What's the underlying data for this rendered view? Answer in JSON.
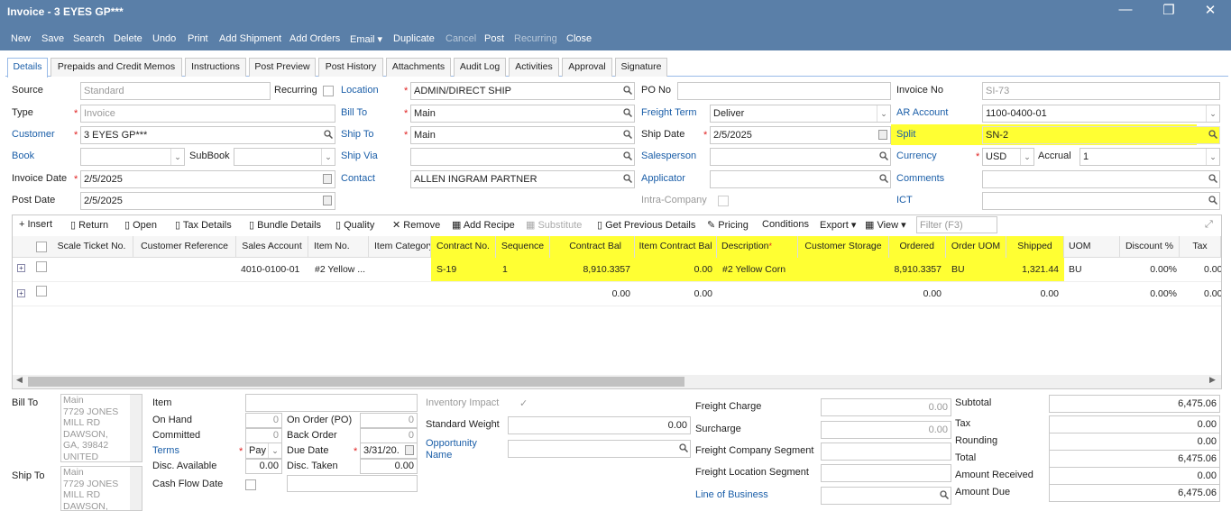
{
  "window": {
    "title": "Invoice - 3 EYES GP***"
  },
  "toolbar": [
    "New",
    "Save",
    "Search",
    "Delete",
    "Undo",
    "Print",
    "Add Shipment",
    "Add Orders",
    "Email ▾",
    "Duplicate",
    "Cancel",
    "Post",
    "Recurring",
    "Close"
  ],
  "tabs": [
    "Details",
    "Prepaids and Credit Memos",
    "Instructions",
    "Post Preview",
    "Post History",
    "Attachments",
    "Audit Log",
    "Activities",
    "Approval",
    "Signature"
  ],
  "form": {
    "source": {
      "label": "Source",
      "value": "Standard"
    },
    "recurring": {
      "label": "Recurring"
    },
    "location": {
      "label": "Location",
      "value": "ADMIN/DIRECT SHIP"
    },
    "po_no": {
      "label": "PO No",
      "value": ""
    },
    "invoice_no": {
      "label": "Invoice No",
      "value": "SI-73"
    },
    "type": {
      "label": "Type",
      "value": "Invoice"
    },
    "bill_to": {
      "label": "Bill To",
      "value": "Main"
    },
    "freight_term": {
      "label": "Freight Term",
      "value": "Deliver"
    },
    "ar_account": {
      "label": "AR Account",
      "value": "1100-0400-01"
    },
    "customer": {
      "label": "Customer",
      "value": "3 EYES GP***"
    },
    "ship_to": {
      "label": "Ship To",
      "value": "Main"
    },
    "ship_date": {
      "label": "Ship Date",
      "value": "2/5/2025"
    },
    "split": {
      "label": "Split",
      "value": "SN-2"
    },
    "book": {
      "label": "Book",
      "value": ""
    },
    "subbook": {
      "label": "SubBook",
      "value": ""
    },
    "ship_via": {
      "label": "Ship Via",
      "value": ""
    },
    "salesperson": {
      "label": "Salesperson",
      "value": ""
    },
    "currency": {
      "label": "Currency",
      "value": "USD"
    },
    "accrual": {
      "label": "Accrual",
      "value": "1"
    },
    "invoice_date": {
      "label": "Invoice Date",
      "value": "2/5/2025"
    },
    "contact": {
      "label": "Contact",
      "value": "ALLEN INGRAM PARTNER"
    },
    "applicator": {
      "label": "Applicator",
      "value": ""
    },
    "comments": {
      "label": "Comments",
      "value": ""
    },
    "post_date": {
      "label": "Post Date",
      "value": "2/5/2025"
    },
    "intra_company": {
      "label": "Intra-Company"
    },
    "ict": {
      "label": "ICT",
      "value": ""
    }
  },
  "grid_toolbar": [
    "Insert",
    "Return",
    "Open",
    "Tax Details",
    "Bundle Details",
    "Quality",
    "Remove",
    "Add Recipe",
    "Substitute",
    "Get Previous Details",
    "Pricing",
    "Conditions",
    "Export ▾",
    "View ▾"
  ],
  "filter_placeholder": "Filter (F3)",
  "columns": [
    "Scale Ticket No.",
    "Customer Reference",
    "Sales Account",
    "Item No.",
    "Item Category",
    "Contract No.",
    "Sequence",
    "Contract Bal",
    "Item Contract Bal",
    "Description",
    "Customer Storage",
    "Ordered",
    "Order UOM",
    "Shipped",
    "UOM",
    "Discount %",
    "Tax"
  ],
  "rows": [
    {
      "scale": "",
      "custref": "",
      "account": "4010-0100-01",
      "item": "#2 Yellow ...",
      "category": "",
      "contract": "S-19",
      "sequence": "1",
      "contract_bal": "8,910.3357",
      "item_contract_bal": "0.00",
      "description": "#2 Yellow Corn",
      "storage": "",
      "ordered": "8,910.3357",
      "order_uom": "BU",
      "shipped": "1,321.44",
      "uom": "BU",
      "discount": "0.00%",
      "tax": "0.00"
    },
    {
      "scale": "",
      "custref": "",
      "account": "",
      "item": "",
      "category": "",
      "contract": "",
      "sequence": "",
      "contract_bal": "0.00",
      "item_contract_bal": "0.00",
      "description": "",
      "storage": "",
      "ordered": "0.00",
      "order_uom": "",
      "shipped": "0.00",
      "uom": "",
      "discount": "0.00%",
      "tax": "0.00"
    }
  ],
  "bottom": {
    "bill_to_label": "Bill To",
    "bill_to_address": "Main\n7729 JONES\nMILL RD\nDAWSON,\nGA, 39842\nUNITED",
    "ship_to_label": "Ship To",
    "ship_to_address": "Main\n7729 JONES\nMILL RD\nDAWSON,",
    "item": "Item",
    "on_hand": "On Hand",
    "on_hand_val": "0",
    "on_order": "On Order (PO)",
    "on_order_val": "0",
    "committed": "Committed",
    "committed_val": "0",
    "back_order": "Back Order",
    "back_order_val": "0",
    "terms": "Terms",
    "terms_val": "Pay",
    "due_date": "Due Date",
    "due_date_val": "3/31/20.",
    "disc_avail": "Disc. Available",
    "disc_avail_val": "0.00",
    "disc_taken": "Disc. Taken",
    "disc_taken_val": "0.00",
    "cash_flow": "Cash Flow Date",
    "inventory_impact": "Inventory Impact",
    "standard_weight": "Standard Weight",
    "standard_weight_val": "0.00",
    "opportunity_name": "Opportunity\nName",
    "freight_charge": "Freight Charge",
    "freight_charge_val": "0.00",
    "surcharge": "Surcharge",
    "surcharge_val": "0.00",
    "freight_company_segment": "Freight Company Segment",
    "freight_location_segment": "Freight Location Segment",
    "line_of_business": "Line of Business",
    "subtotal": "Subtotal",
    "subtotal_val": "6,475.06",
    "tax": "Tax",
    "tax_val": "0.00",
    "rounding": "Rounding",
    "rounding_val": "0.00",
    "total": "Total",
    "total_val": "6,475.06",
    "amount_received": "Amount Received",
    "amount_received_val": "0.00",
    "amount_due": "Amount Due",
    "amount_due_val": "6,475.06"
  },
  "colors": {
    "titlebar": "#5a7fa8",
    "link": "#1a5ea8",
    "highlight": "#ffff33"
  }
}
